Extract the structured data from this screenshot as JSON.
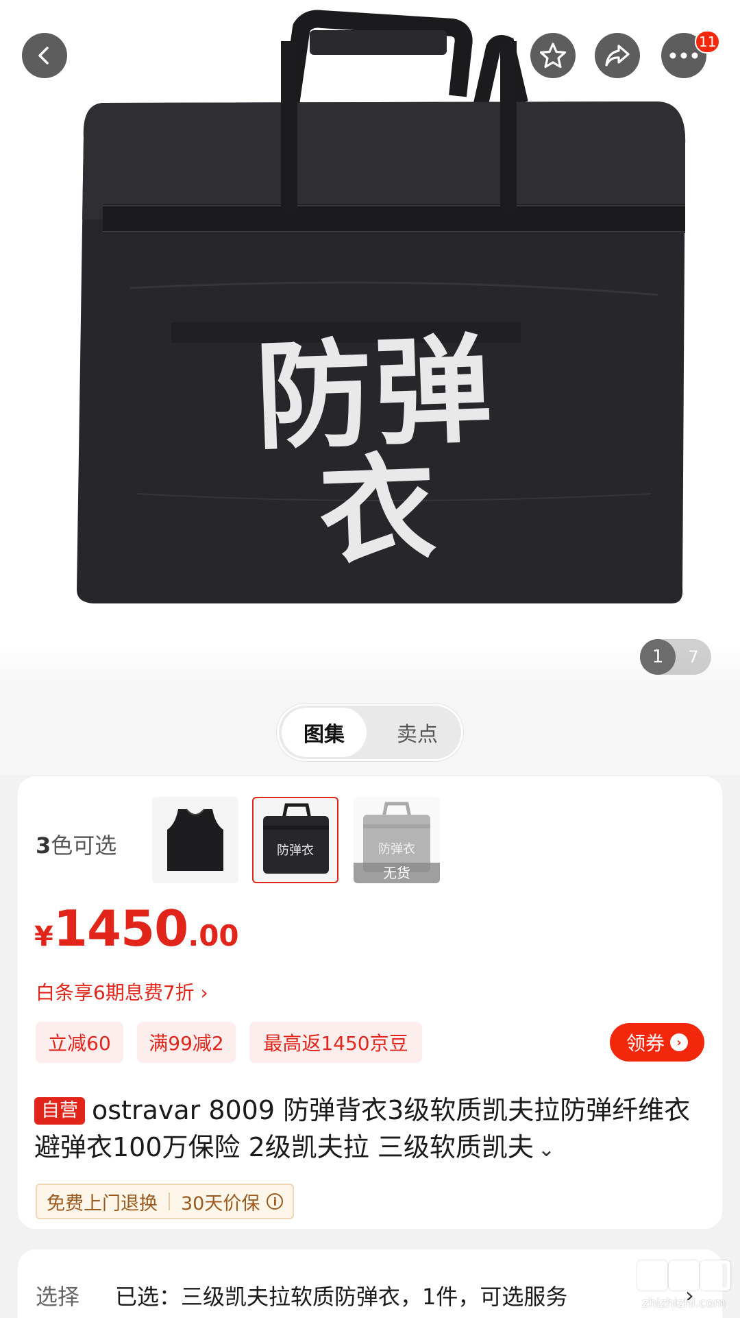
{
  "hero": {
    "bag_print": "防弹衣",
    "pager": {
      "current": "1",
      "total": "7"
    },
    "more_badge": "11"
  },
  "segment": {
    "tabs": [
      "图集",
      "卖点"
    ],
    "active": "图集"
  },
  "product": {
    "colors_label_num": "3",
    "colors_label_text": "色可选",
    "swatches": [
      {
        "name": "black-vest",
        "label": ""
      },
      {
        "name": "bag",
        "label": "防弹衣",
        "selected": true
      },
      {
        "name": "bag-gray",
        "label": "防弹衣",
        "status": "无货"
      }
    ],
    "price": {
      "currency": "¥",
      "integer": "1450",
      "decimal": ".00"
    },
    "baitiao": "白条享6期息费7折 ›",
    "coupons": [
      "立减60",
      "满99减2",
      "最高返1450京豆"
    ],
    "get_coupon": "领券",
    "self_tag": "自营",
    "title": "ostravar 8009 防弹背衣3级软质凯夫拉防弹纤维衣避弹衣100万保险 2级凯夫拉  三级软质凯夫",
    "expand": "⌄",
    "services": [
      "免费上门退换",
      "30天价保"
    ]
  },
  "select": {
    "label": "选择",
    "value": "已选：三级凯夫拉软质防弹衣，1件，可选服务",
    "arrow": "›"
  },
  "watermark": {
    "text": "zhizhizhi.com"
  },
  "colors": {
    "accent": "#e1251b",
    "badge": "#f2270c"
  }
}
